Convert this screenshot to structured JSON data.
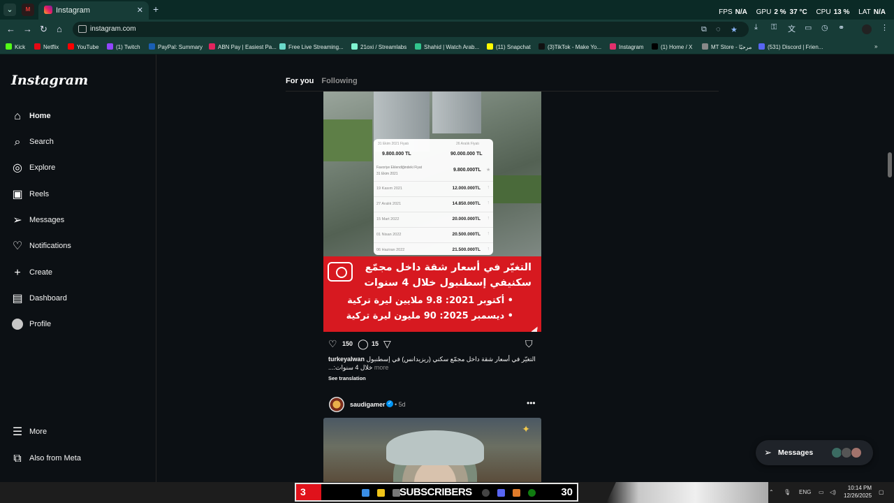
{
  "browser": {
    "tab_title": "Instagram",
    "url": "instagram.com",
    "hud": {
      "fps_label": "FPS",
      "fps": "N/A",
      "gpu_label": "GPU",
      "gpu": "2 %",
      "gpu_temp": "37 °C",
      "cpu_label": "CPU",
      "cpu": "13 %",
      "lat_label": "LAT",
      "lat": "N/A"
    },
    "bookmarks": [
      {
        "label": "Kick",
        "color": "#53fc18"
      },
      {
        "label": "Netflix",
        "color": "#e50914"
      },
      {
        "label": "YouTube",
        "color": "#ff0000"
      },
      {
        "label": "(1) Twitch",
        "color": "#9146ff"
      },
      {
        "label": "PayPal: Summary",
        "color": "#1a5fb4"
      },
      {
        "label": "ABN Pay | Easiest Pa...",
        "color": "#e0245e"
      },
      {
        "label": "Free Live Streaming...",
        "color": "#6ad9c9"
      },
      {
        "label": "21oxi / Streamlabs",
        "color": "#80f5d2"
      },
      {
        "label": "Shahid | Watch Arab...",
        "color": "#32c48d"
      },
      {
        "label": "(11) Snapchat",
        "color": "#fffc00"
      },
      {
        "label": "(3)TikTok - Make Yo...",
        "color": "#111111"
      },
      {
        "label": "Instagram",
        "color": "#e1306c"
      },
      {
        "label": "(1) Home / X",
        "color": "#000000"
      },
      {
        "label": "MT Store - مرحبًا",
        "color": "#888888"
      },
      {
        "label": "(531) Discord | Frien...",
        "color": "#5865f2"
      }
    ]
  },
  "sidebar": {
    "logo": "Instagram",
    "items": [
      {
        "label": "Home",
        "icon": "home-icon"
      },
      {
        "label": "Search",
        "icon": "search-icon"
      },
      {
        "label": "Explore",
        "icon": "compass-icon"
      },
      {
        "label": "Reels",
        "icon": "reels-icon"
      },
      {
        "label": "Messages",
        "icon": "messenger-icon"
      },
      {
        "label": "Notifications",
        "icon": "heart-icon"
      },
      {
        "label": "Create",
        "icon": "plus-icon"
      },
      {
        "label": "Dashboard",
        "icon": "dashboard-icon"
      },
      {
        "label": "Profile",
        "icon": "avatar"
      }
    ],
    "bottom": [
      {
        "label": "More",
        "icon": "menu-icon"
      },
      {
        "label": "Also from Meta",
        "icon": "meta-icon"
      }
    ]
  },
  "feed": {
    "tab_for_you": "For you",
    "tab_following": "Following"
  },
  "post1": {
    "card": {
      "date_left": "31 Ekim 2021 Fiyatı",
      "date_right": "26 Aralık Fiyatı",
      "price_left": "9.800.000 TL",
      "price_right": "90.000.000 TL",
      "fav_label": "Favoriye Eklendiğindeki Fiyat",
      "fav_date": "31 Ekim 2021",
      "fav_price": "9.800.000TL",
      "rows": [
        {
          "date": "19 Kasım 2021",
          "value": "12.000.000TL"
        },
        {
          "date": "27 Aralık 2021",
          "value": "14.850.000TL"
        },
        {
          "date": "15 Mart 2022",
          "value": "20.000.000TL"
        },
        {
          "date": "01 Nisan 2022",
          "value": "20.500.000TL"
        },
        {
          "date": "06 Haziran 2022",
          "value": "21.500.000TL"
        }
      ]
    },
    "banner": {
      "line1": "التغيّر في أسعار شقة داخل مجمّع",
      "line2": "سكنيفي إسطنبول خلال 4 سنوات",
      "line3": "• أكتوبر 2021: 9.8 ملايين ليرة تركية",
      "line4": "• ديسمبر 2025: 90 مليون ليرة تركية"
    },
    "likes": "150",
    "comments": "15",
    "caption_user": "turkeyalwan",
    "caption_text": "التغيّر في أسعار شقة داخل مجمّع سكني (ريزيدانس) في إسطنبول خلال 4 سنوات:...",
    "more": "more",
    "see_translation": "See translation"
  },
  "post2": {
    "username": "saudigamer",
    "time": "5d"
  },
  "messages_pill": {
    "label": "Messages"
  },
  "taskbar": {
    "sub_left": "3",
    "sub_label": "SUBSCRIBERS",
    "sub_right": "30",
    "lang": "ENG",
    "time": "10:14 PM",
    "date": "12/26/2025"
  }
}
